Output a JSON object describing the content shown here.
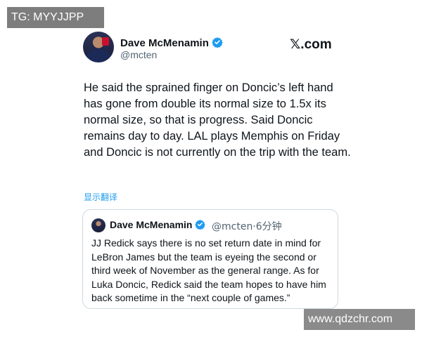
{
  "watermarks": {
    "top": "TG: MYYJJPP",
    "bottom": "www.qdzchr.com"
  },
  "post": {
    "author_name": "Dave McMenamin",
    "handle": "@mcten",
    "site_brand": "𝕏.com",
    "text": "He said the sprained finger on Doncic’s left hand has gone from double its normal size to 1.5x its normal size, so that is progress. Said Doncic remains day to day. LAL plays Memphis on Friday and Doncic is not currently on the trip with the team.",
    "translate_label": "显示翻译"
  },
  "quoted_post": {
    "author_name": "Dave McMenamin",
    "meta": "@mcten·6分钟",
    "text": "JJ Redick says there is no set return date in mind for LeBron James but the team is eyeing the second or third week of November as the general range. As for Luka Doncic, Redick said the team hopes to have him back sometime in the “next couple of games.”"
  },
  "colors": {
    "verified_blue": "#1d9bf0",
    "link_blue": "#1d9bf0",
    "secondary_text": "#536471",
    "border": "#cfd9de"
  },
  "icons": {
    "verified": "verified-badge-icon",
    "avatar": "avatar"
  }
}
